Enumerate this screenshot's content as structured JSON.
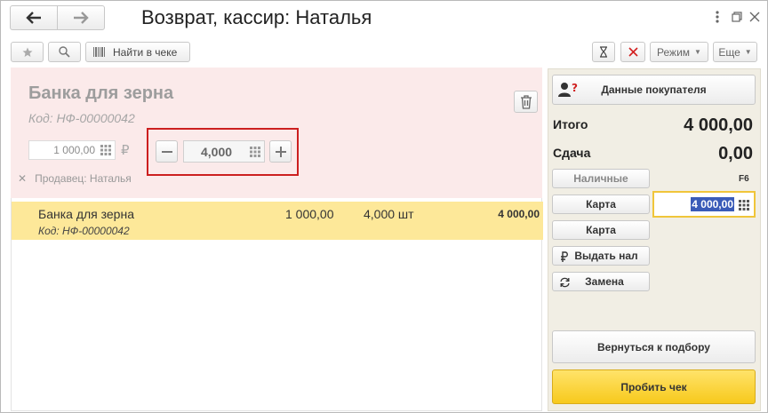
{
  "window": {
    "title": "Возврат, кассир: Наталья"
  },
  "toolbar": {
    "find_in_receipt": "Найти в чеке",
    "mode": "Режим",
    "more": "Еще"
  },
  "editor": {
    "product_name": "Банка для зерна",
    "product_code": "Код: НФ-00000042",
    "price": "1 000,00",
    "currency": "₽",
    "quantity": "4,000",
    "seller": "Продавец: Наталья"
  },
  "items": [
    {
      "name": "Банка для зерна",
      "code": "Код: НФ-00000042",
      "price": "1 000,00",
      "quantity": "4,000 шт",
      "sum": "4 000,00"
    }
  ],
  "payment": {
    "customer_data": "Данные покупателя",
    "total_label": "Итого",
    "total_value": "4 000,00",
    "change_label": "Сдача",
    "change_value": "0,00",
    "cash": "Наличные",
    "cash_hotkey": "F6",
    "card1": "Карта",
    "card1_amount": "4 000,00",
    "card2": "Карта",
    "cash_out": "Выдать нал",
    "replace": "Замена",
    "back_to_selection": "Вернуться к подбору",
    "print_receipt": "Пробить чек"
  },
  "colors": {
    "selected_row": "#fde899",
    "editor_bg": "#fbeaea",
    "highlight_border": "#cc1f1f",
    "primary_button": "#f7c91c",
    "right_panel": "#f1eee4"
  }
}
